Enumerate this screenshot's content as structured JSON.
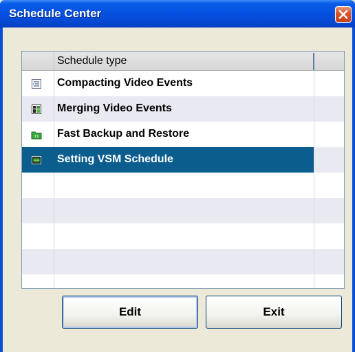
{
  "window": {
    "title": "Schedule Center"
  },
  "list": {
    "header": "Schedule type",
    "rows": [
      {
        "label": "Compacting Video Events",
        "icon": "compact-events-icon"
      },
      {
        "label": "Merging Video Events",
        "icon": "merge-events-icon"
      },
      {
        "label": "Fast Backup and Restore",
        "icon": "backup-folder-icon"
      },
      {
        "label": "Setting VSM Schedule",
        "icon": "vsm-schedule-icon",
        "selected": true
      }
    ]
  },
  "buttons": {
    "edit": "Edit",
    "exit": "Exit"
  },
  "colors": {
    "selection": "#0b5d8e",
    "titlebar": "#0551e3",
    "close": "#d9562f"
  }
}
